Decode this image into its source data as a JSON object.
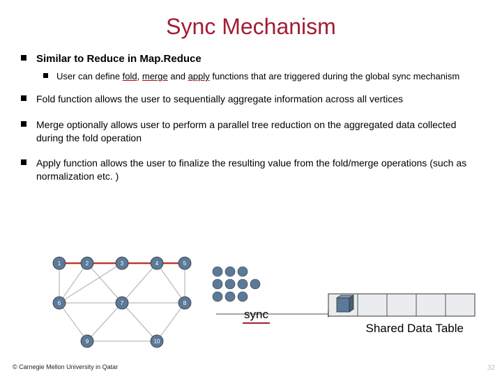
{
  "title": "Sync Mechanism",
  "bullets": {
    "b1": "Similar to Reduce in Map.Reduce",
    "b1a_pre": "User can define ",
    "b1a_fold": "fold",
    "b1a_mid1": ", ",
    "b1a_merge": "merge",
    "b1a_mid2": " and ",
    "b1a_apply": "apply",
    "b1a_post": " functions that are triggered during the global sync mechanism",
    "b2": "Fold function allows the user to sequentially aggregate information across all vertices",
    "b3": "Merge optionally allows user to perform a parallel tree reduction on the aggregated data collected during the fold operation",
    "b4": "Apply function allows the user to finalize the resulting value from the fold/merge operations (such as normalization etc. )"
  },
  "sync_label": "sync",
  "table_label": "Shared Data Table",
  "footer": "© Carnegie Mellon University in Qatar",
  "page": "32"
}
